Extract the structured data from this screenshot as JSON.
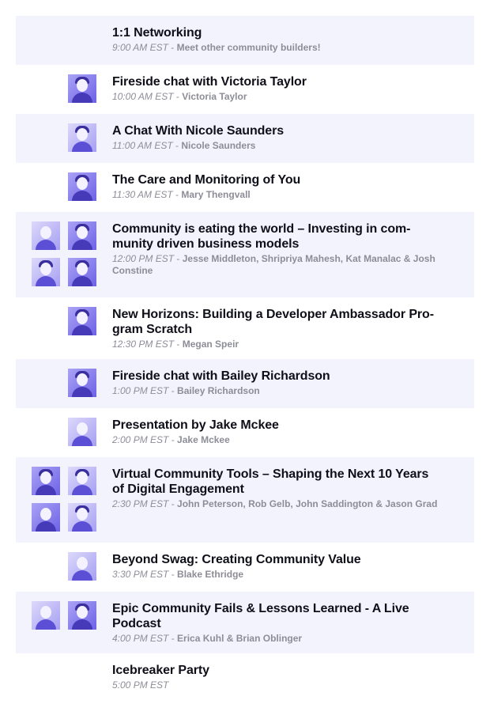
{
  "sessions": [
    {
      "title": "1:1 Networking",
      "time": "9:00 AM EST",
      "separator": " - ",
      "speakers": "Meet other community builders!"
    },
    {
      "title": "Fireside chat with Victoria Taylor",
      "time": "10:00 AM EST",
      "separator": " - ",
      "speakers": "Victoria Taylor"
    },
    {
      "title": "A Chat With Nicole Saunders",
      "time": "11:00 AM EST",
      "separator": " - ",
      "speakers": "Nicole Saunders"
    },
    {
      "title": "The Care and Monitoring of You",
      "time": "11:30 AM EST",
      "separator": " - ",
      "speakers": "Mary Thengvall"
    },
    {
      "title": "Community is eating the world – Investing in com-munity driven business models",
      "time": "12:00 PM EST",
      "separator": " - ",
      "speakers": "Jesse Middleton, Shripriya Mahesh, Kat Manalac & Josh Constine"
    },
    {
      "title": "New Horizons: Building a Developer Ambassador Pro-gram Scratch",
      "time": "12:30 PM EST",
      "separator": " - ",
      "speakers": "Megan Speir"
    },
    {
      "title": "Fireside chat with Bailey Richardson",
      "time": "1:00 PM EST",
      "separator": " - ",
      "speakers": "Bailey Richardson"
    },
    {
      "title": "Presentation by Jake Mckee",
      "time": "2:00 PM EST",
      "separator": " - ",
      "speakers": "Jake Mckee"
    },
    {
      "title": "Virtual Community Tools – Shaping the Next 10 Years of Digital Engagement",
      "time": "2:30 PM EST",
      "separator": " - ",
      "speakers": "John Peterson, Rob Gelb, John Saddington & Jason Grad"
    },
    {
      "title": "Beyond Swag: Creating Community Value",
      "time": "3:30 PM EST",
      "separator": " - ",
      "speakers": "Blake Ethridge"
    },
    {
      "title": "Epic Community Fails & Lessons Learned - A Live Podcast",
      "time": "4:00 PM EST",
      "separator": " - ",
      "speakers": "Erica Kuhl & Brian Oblinger"
    },
    {
      "title": "Icebreaker Party",
      "time": "5:00 PM EST",
      "separator": "",
      "speakers": ""
    }
  ],
  "colors": {
    "row_shade": "#f3f3fd",
    "title_text": "#0f0f19",
    "meta_text": "#8d8d98",
    "avatar_tint": "#6e62e6"
  }
}
